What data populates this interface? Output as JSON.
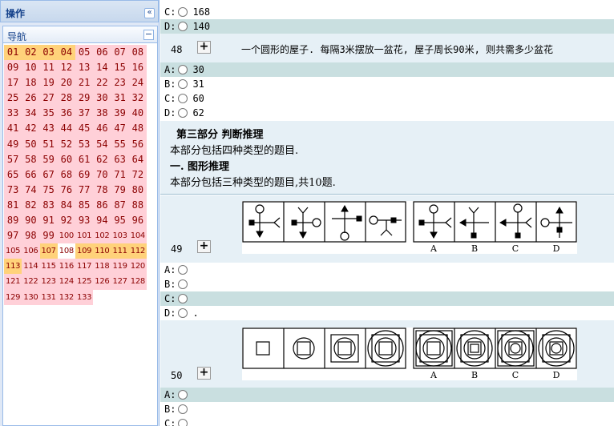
{
  "left_panel": {
    "title": "操作",
    "collapse_icon": "«",
    "nav_title": "导航",
    "nav_collapse_icon": "−",
    "questions": [
      "01",
      "02",
      "03",
      "04",
      "05",
      "06",
      "07",
      "08",
      "09",
      "10",
      "11",
      "12",
      "13",
      "14",
      "15",
      "16",
      "17",
      "18",
      "19",
      "20",
      "21",
      "22",
      "23",
      "24",
      "25",
      "26",
      "27",
      "28",
      "29",
      "30",
      "31",
      "32",
      "33",
      "34",
      "35",
      "36",
      "37",
      "38",
      "39",
      "40",
      "41",
      "42",
      "43",
      "44",
      "45",
      "46",
      "47",
      "48",
      "49",
      "50",
      "51",
      "52",
      "53",
      "54",
      "55",
      "56",
      "57",
      "58",
      "59",
      "60",
      "61",
      "62",
      "63",
      "64",
      "65",
      "66",
      "67",
      "68",
      "69",
      "70",
      "71",
      "72",
      "73",
      "74",
      "75",
      "76",
      "77",
      "78",
      "79",
      "80",
      "81",
      "82",
      "83",
      "84",
      "85",
      "86",
      "87",
      "88",
      "89",
      "90",
      "91",
      "92",
      "93",
      "94",
      "95",
      "96",
      "97",
      "98",
      "99",
      "100",
      "101",
      "102",
      "103",
      "104",
      "105",
      "106",
      "107",
      "108",
      "109",
      "110",
      "111",
      "112",
      "113",
      "114",
      "115",
      "116",
      "117",
      "118",
      "119",
      "120",
      "121",
      "122",
      "123",
      "124",
      "125",
      "126",
      "127",
      "128",
      "129",
      "130",
      "131",
      "132",
      "133"
    ],
    "answered": [
      "01",
      "02",
      "03",
      "04",
      "107",
      "109",
      "110",
      "111",
      "112",
      "113"
    ],
    "current": [
      "108"
    ],
    "colors": {
      "unanswered": "#ffd0d8",
      "answered": "#ffd27a",
      "text": "#8b0000"
    }
  },
  "main": {
    "q47_partial": [
      {
        "letter": "C:",
        "value": "168"
      },
      {
        "letter": "D:",
        "value": "140"
      }
    ],
    "q48": {
      "number": "48",
      "plus": "+",
      "text": "一个圆形的屋子. 每隔3米摆放一盆花, 屋子周长90米, 则共需多少盆花",
      "options": [
        {
          "letter": "A:",
          "value": "30"
        },
        {
          "letter": "B:",
          "value": "31"
        },
        {
          "letter": "C:",
          "value": "60"
        },
        {
          "letter": "D:",
          "value": "62"
        }
      ]
    },
    "section": {
      "title": "第三部分  判断推理",
      "line1": "本部分包括四种类型的题目.",
      "subtitle": "一. 图形推理",
      "line2": "本部分包括三种类型的题目,共10题."
    },
    "q49": {
      "number": "49",
      "plus": "+",
      "choice_labels": [
        "A",
        "B",
        "C",
        "D"
      ],
      "options": [
        {
          "letter": "A:",
          "value": ""
        },
        {
          "letter": "B:",
          "value": ""
        },
        {
          "letter": "C:",
          "value": ""
        },
        {
          "letter": "D:",
          "value": "."
        }
      ]
    },
    "q50": {
      "number": "50",
      "plus": "+",
      "choice_labels": [
        "A",
        "B",
        "C",
        "D"
      ],
      "options": [
        {
          "letter": "A:",
          "value": ""
        },
        {
          "letter": "B:",
          "value": ""
        },
        {
          "letter": "C:",
          "value": ""
        }
      ]
    }
  }
}
